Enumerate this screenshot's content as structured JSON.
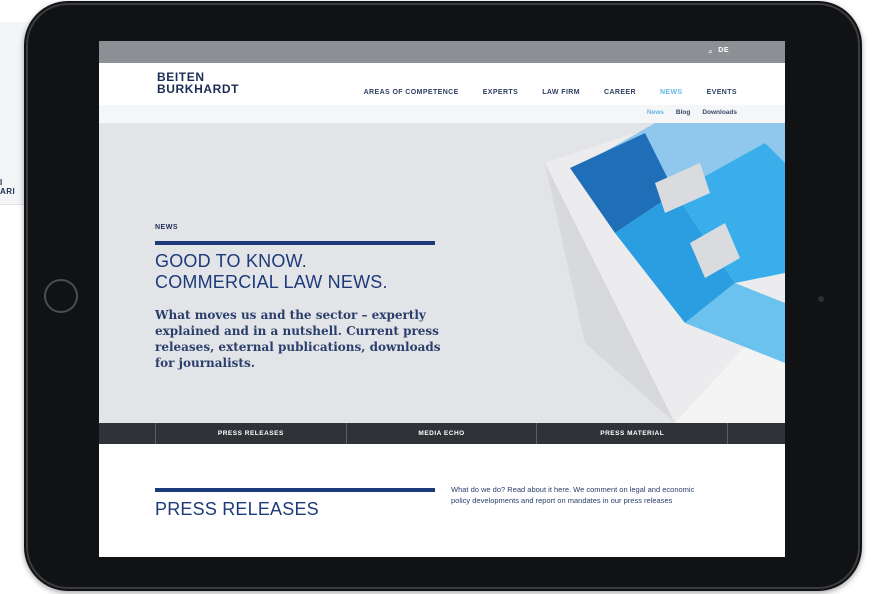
{
  "background": {
    "logo_fragment": "I\nARI"
  },
  "site": {
    "brand_line1": "BEITEN",
    "brand_line2": "BURKHARDT",
    "topbar": {
      "search_icon": "search-icon",
      "language": "DE"
    },
    "nav": [
      {
        "label": "AREAS OF COMPETENCE",
        "active": false
      },
      {
        "label": "EXPERTS",
        "active": false
      },
      {
        "label": "LAW FIRM",
        "active": false
      },
      {
        "label": "CAREER",
        "active": false
      },
      {
        "label": "NEWS",
        "active": true
      },
      {
        "label": "EVENTS",
        "active": false
      }
    ],
    "subnav": [
      {
        "label": "News",
        "active": true
      },
      {
        "label": "Blog",
        "active": false
      },
      {
        "label": "Downloads",
        "active": false
      }
    ],
    "hero": {
      "eyebrow": "NEWS",
      "title_line1": "GOOD TO KNOW.",
      "title_line2": "COMMERCIAL LAW NEWS.",
      "text": "What moves us and the sector – expertly explained and in a nutshell. Current press releases, external publications, downloads for journalists."
    },
    "tabs": [
      "PRESS RELEASES",
      "MEDIA ECHO",
      "PRESS MATERIAL"
    ],
    "section": {
      "title": "PRESS RELEASES",
      "text": "What do we do? Read about it here. We comment on legal and economic policy developments and report on mandates in our press releases"
    }
  },
  "colors": {
    "brand_navy": "#1d3a7a",
    "accent_blue": "#63b7e6",
    "tab_bar": "#2f3236",
    "hero_bg": "#e2e4e7"
  }
}
